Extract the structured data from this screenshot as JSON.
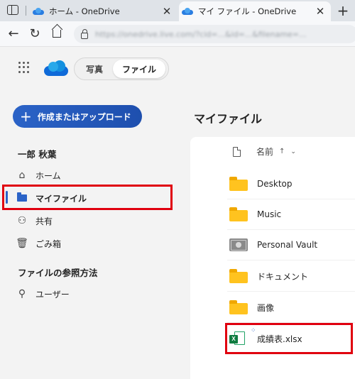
{
  "browser": {
    "tabs": [
      {
        "title": "ホーム - OneDrive",
        "active": false
      },
      {
        "title": "マイ ファイル - OneDrive",
        "active": true
      }
    ],
    "close_glyph": "✕",
    "new_tab_glyph": "+",
    "url": "https://onedrive.live.com/?cid=...&id=...&filename=..."
  },
  "app": {
    "segments": {
      "photos": "写真",
      "files": "ファイル"
    },
    "selected_segment": "files"
  },
  "sidebar": {
    "create_button": "作成またはアップロード",
    "user_name": "一郎 秋葉",
    "items": [
      {
        "label": "ホーム",
        "icon": "home-icon",
        "selected": false
      },
      {
        "label": "マイファイル",
        "icon": "folder-icon",
        "selected": true
      },
      {
        "label": "共有",
        "icon": "people-icon",
        "selected": false
      },
      {
        "label": "ごみ箱",
        "icon": "trash-icon",
        "selected": false
      }
    ],
    "browse_heading": "ファイルの参照方法",
    "browse_items": [
      {
        "label": "ユーザー",
        "icon": "person-icon"
      }
    ]
  },
  "main": {
    "title": "マイファイル",
    "column_name": "名前",
    "sort_glyph": "↑",
    "chevron_glyph": "⌄",
    "files": [
      {
        "name": "Desktop",
        "type": "folder"
      },
      {
        "name": "Music",
        "type": "folder"
      },
      {
        "name": "Personal Vault",
        "type": "vault"
      },
      {
        "name": "ドキュメント",
        "type": "folder"
      },
      {
        "name": "画像",
        "type": "folder"
      },
      {
        "name": "成績表.xlsx",
        "type": "excel"
      }
    ]
  },
  "colors": {
    "accent": "#2b63c7",
    "highlight": "#e0000f",
    "folder": "#ffc31f"
  }
}
